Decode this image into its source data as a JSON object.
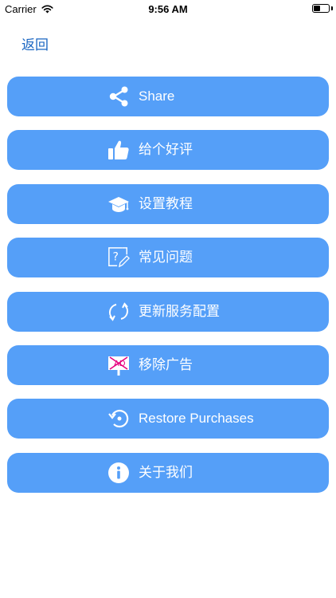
{
  "status_bar": {
    "carrier": "Carrier",
    "time": "9:56 AM",
    "battery_level": 0.45
  },
  "nav": {
    "back_label": "返回"
  },
  "menu": {
    "items": [
      {
        "label": "Share",
        "icon": "share-icon"
      },
      {
        "label": "给个好评",
        "icon": "thumbs-up-icon"
      },
      {
        "label": "设置教程",
        "icon": "graduation-cap-icon"
      },
      {
        "label": "常见问题",
        "icon": "help-edit-icon"
      },
      {
        "label": "更新服务配置",
        "icon": "refresh-icon"
      },
      {
        "label": "移除广告",
        "icon": "remove-ad-icon"
      },
      {
        "label": "Restore Purchases",
        "icon": "restore-icon"
      },
      {
        "label": "关于我们",
        "icon": "info-icon"
      }
    ]
  },
  "colors": {
    "button_bg": "#559ff8",
    "back_link": "#1a66c2",
    "ad_icon_bg": "#e6007e"
  }
}
